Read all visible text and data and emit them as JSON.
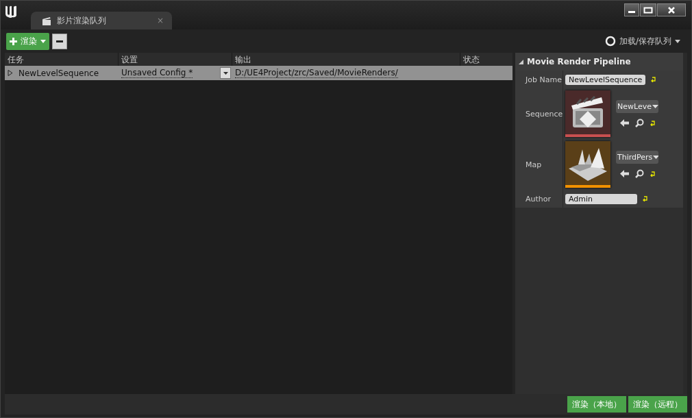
{
  "window": {
    "tab_title": "影片渲染队列",
    "tab_close": "×"
  },
  "toolbar": {
    "add_button": "渲染",
    "load_save": "加载/保存队列"
  },
  "table": {
    "columns": [
      "任务",
      "设置",
      "输出",
      "状态"
    ],
    "rows": [
      {
        "job": "NewLevelSequence",
        "settings": "Unsaved Config *",
        "output": "D:/UE4Project/zrc/Saved/MovieRenders/",
        "selected": true,
        "expanded": false
      }
    ]
  },
  "details": {
    "title": "Movie Render Pipeline",
    "expanded": true,
    "fields": [
      {
        "kind": "text",
        "label": "Job Name",
        "value": "NewLevelSequence"
      },
      {
        "kind": "sequence",
        "label": "Sequence",
        "value": "NewLeve",
        "color": "#c84f4f"
      },
      {
        "kind": "map",
        "label": "Map",
        "value": "ThirdPers",
        "color": "#f29100"
      },
      {
        "kind": "text",
        "label": "Author",
        "value": "Admin"
      }
    ]
  },
  "footer": {
    "buttons": [
      "渲染（本地）",
      "渲染（远程）"
    ]
  }
}
